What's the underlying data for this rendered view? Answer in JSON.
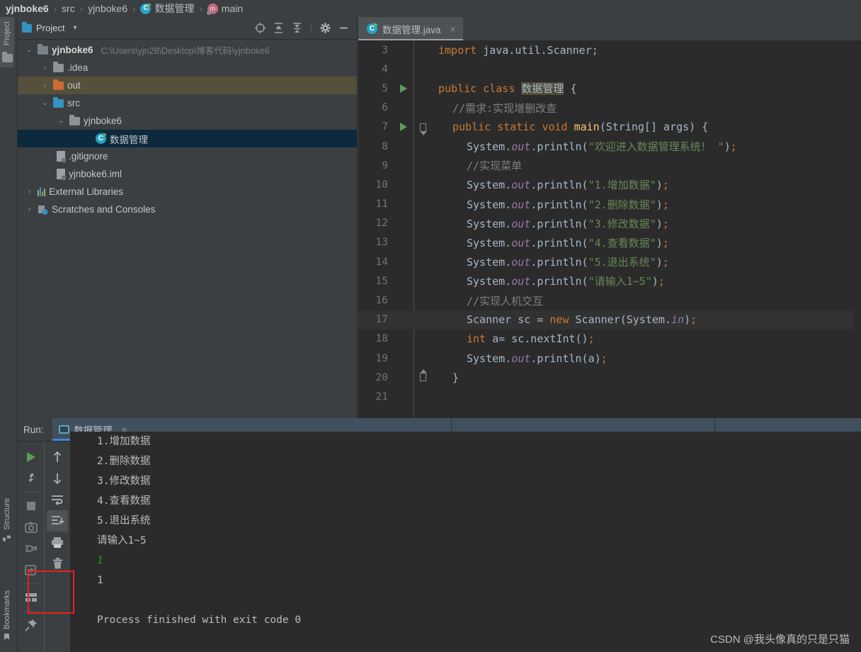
{
  "breadcrumb": {
    "items": [
      {
        "label": "yjnboke6",
        "bold": true,
        "icon": null
      },
      {
        "label": "src",
        "bold": false,
        "icon": null
      },
      {
        "label": "yjnboke6",
        "bold": false,
        "icon": null
      },
      {
        "label": "数据管理",
        "bold": false,
        "icon": "java-class-icon"
      },
      {
        "label": "main",
        "bold": false,
        "icon": "java-method-icon"
      }
    ],
    "separator": "›"
  },
  "tool_strip": {
    "project_label": "Project",
    "structure_label": "Structure",
    "bookmarks_label": "Bookmarks"
  },
  "project_panel": {
    "title": "Project",
    "dropdown_caret": "▾",
    "icons": [
      "locate-icon",
      "expand-all-icon",
      "collapse-all-icon",
      "settings-icon",
      "hide-icon"
    ],
    "tree": [
      {
        "depth": 0,
        "arrow": "⌄",
        "icon": "module-folder-icon",
        "color": "#7a8287",
        "label": "yjnboke6",
        "bold": true,
        "path": "C:\\Users\\yjn28\\Desktop\\博客代码\\yjnboke6",
        "state": "none"
      },
      {
        "depth": 1,
        "arrow": "›",
        "icon": "folder-icon",
        "color": "#8d9499",
        "label": ".idea",
        "bold": false,
        "path": "",
        "state": "none"
      },
      {
        "depth": 1,
        "arrow": "›",
        "icon": "folder-icon",
        "color": "#cc7832",
        "label": "out",
        "bold": false,
        "path": "",
        "state": "out-selected"
      },
      {
        "depth": 1,
        "arrow": "⌄",
        "icon": "source-folder-icon",
        "color": "#3592c4",
        "label": "src",
        "bold": false,
        "path": "",
        "state": "none"
      },
      {
        "depth": 2,
        "arrow": "⌄",
        "icon": "package-icon",
        "color": "#8d9499",
        "label": "yjnboke6",
        "bold": false,
        "path": "",
        "state": "none"
      },
      {
        "depth": 3,
        "arrow": "",
        "icon": "java-class-icon",
        "color": "",
        "label": "数据管理",
        "bold": false,
        "path": "",
        "state": "focused"
      },
      {
        "depth": 2,
        "arrow": "",
        "icon": "gitignore-file-icon",
        "color": "",
        "label": ".gitignore",
        "bold": false,
        "path": "",
        "state": "none"
      },
      {
        "depth": 2,
        "arrow": "",
        "icon": "iml-file-icon",
        "color": "",
        "label": "yjnboke6.iml",
        "bold": false,
        "path": "",
        "state": "none"
      },
      {
        "depth": 0,
        "arrow": "›",
        "icon": "external-libraries-icon",
        "color": "",
        "label": "External Libraries",
        "bold": false,
        "path": "",
        "state": "none"
      },
      {
        "depth": 0,
        "arrow": "›",
        "icon": "scratches-icon",
        "color": "",
        "label": "Scratches and Consoles",
        "bold": false,
        "path": "",
        "state": "none"
      }
    ]
  },
  "editor": {
    "tab": {
      "label": "数据管理.java",
      "icon": "java-class-icon",
      "close": "×"
    },
    "lines": [
      {
        "n": "3",
        "run": false,
        "fold": "",
        "hl": false,
        "tokens": [
          {
            "t": "import ",
            "c": "kw"
          },
          {
            "t": "java.util.Scanner;",
            "c": "plain"
          }
        ],
        "indent": 1
      },
      {
        "n": "4",
        "run": false,
        "fold": "",
        "hl": false,
        "tokens": [],
        "indent": 1
      },
      {
        "n": "5",
        "run": true,
        "fold": "",
        "hl": false,
        "tokens": [
          {
            "t": "public ",
            "c": "kw"
          },
          {
            "t": "class ",
            "c": "kw"
          },
          {
            "t": "数据管理",
            "c": "hlid"
          },
          {
            "t": " {",
            "c": "plain"
          }
        ],
        "indent": 1
      },
      {
        "n": "6",
        "run": false,
        "fold": "",
        "hl": false,
        "tokens": [
          {
            "t": "//需求:实现增删改查",
            "c": "cmt"
          }
        ],
        "indent": 2
      },
      {
        "n": "7",
        "run": true,
        "fold": "start",
        "hl": false,
        "tokens": [
          {
            "t": "public ",
            "c": "kw"
          },
          {
            "t": "static ",
            "c": "kw"
          },
          {
            "t": "void ",
            "c": "kw"
          },
          {
            "t": "main",
            "c": "mth"
          },
          {
            "t": "(String[] args) {",
            "c": "plain"
          }
        ],
        "indent": 2
      },
      {
        "n": "8",
        "run": false,
        "fold": "",
        "hl": false,
        "tokens": [
          {
            "t": "System.",
            "c": "plain"
          },
          {
            "t": "out",
            "c": "field"
          },
          {
            "t": ".println(",
            "c": "plain"
          },
          {
            "t": "\"欢迎进入数据管理系统！ \"",
            "c": "str"
          },
          {
            "t": ")",
            "c": "plain"
          },
          {
            "t": ";",
            "c": "kw2"
          }
        ],
        "indent": 3
      },
      {
        "n": "9",
        "run": false,
        "fold": "",
        "hl": false,
        "tokens": [
          {
            "t": "//实现菜单",
            "c": "cmt"
          }
        ],
        "indent": 3
      },
      {
        "n": "10",
        "run": false,
        "fold": "",
        "hl": false,
        "tokens": [
          {
            "t": "System.",
            "c": "plain"
          },
          {
            "t": "out",
            "c": "field"
          },
          {
            "t": ".println(",
            "c": "plain"
          },
          {
            "t": "\"1.增加数据\"",
            "c": "str"
          },
          {
            "t": ")",
            "c": "plain"
          },
          {
            "t": ";",
            "c": "kw2"
          }
        ],
        "indent": 3
      },
      {
        "n": "11",
        "run": false,
        "fold": "",
        "hl": false,
        "tokens": [
          {
            "t": "System.",
            "c": "plain"
          },
          {
            "t": "out",
            "c": "field"
          },
          {
            "t": ".println(",
            "c": "plain"
          },
          {
            "t": "\"2.删除数据\"",
            "c": "str"
          },
          {
            "t": ")",
            "c": "plain"
          },
          {
            "t": ";",
            "c": "kw2"
          }
        ],
        "indent": 3
      },
      {
        "n": "12",
        "run": false,
        "fold": "",
        "hl": false,
        "tokens": [
          {
            "t": "System.",
            "c": "plain"
          },
          {
            "t": "out",
            "c": "field"
          },
          {
            "t": ".println(",
            "c": "plain"
          },
          {
            "t": "\"3.修改数据\"",
            "c": "str"
          },
          {
            "t": ")",
            "c": "plain"
          },
          {
            "t": ";",
            "c": "kw2"
          }
        ],
        "indent": 3
      },
      {
        "n": "13",
        "run": false,
        "fold": "",
        "hl": false,
        "tokens": [
          {
            "t": "System.",
            "c": "plain"
          },
          {
            "t": "out",
            "c": "field"
          },
          {
            "t": ".println(",
            "c": "plain"
          },
          {
            "t": "\"4.查看数据\"",
            "c": "str"
          },
          {
            "t": ")",
            "c": "plain"
          },
          {
            "t": ";",
            "c": "kw2"
          }
        ],
        "indent": 3
      },
      {
        "n": "14",
        "run": false,
        "fold": "",
        "hl": false,
        "tokens": [
          {
            "t": "System.",
            "c": "plain"
          },
          {
            "t": "out",
            "c": "field"
          },
          {
            "t": ".println(",
            "c": "plain"
          },
          {
            "t": "\"5.退出系统\"",
            "c": "str"
          },
          {
            "t": ")",
            "c": "plain"
          },
          {
            "t": ";",
            "c": "kw2"
          }
        ],
        "indent": 3
      },
      {
        "n": "15",
        "run": false,
        "fold": "",
        "hl": false,
        "tokens": [
          {
            "t": "System.",
            "c": "plain"
          },
          {
            "t": "out",
            "c": "field"
          },
          {
            "t": ".println(",
            "c": "plain"
          },
          {
            "t": "\"请输入1~5\"",
            "c": "str"
          },
          {
            "t": ")",
            "c": "plain"
          },
          {
            "t": ";",
            "c": "kw2"
          }
        ],
        "indent": 3
      },
      {
        "n": "16",
        "run": false,
        "fold": "",
        "hl": false,
        "tokens": [
          {
            "t": "//实现人机交互",
            "c": "cmt"
          }
        ],
        "indent": 3
      },
      {
        "n": "17",
        "run": false,
        "fold": "",
        "hl": true,
        "tokens": [
          {
            "t": "Scanner sc = ",
            "c": "plain"
          },
          {
            "t": "new ",
            "c": "kw"
          },
          {
            "t": "Scanner(System.",
            "c": "plain"
          },
          {
            "t": "in",
            "c": "field"
          },
          {
            "t": ")",
            "c": "plain"
          },
          {
            "t": ";",
            "c": "kw2"
          }
        ],
        "indent": 3
      },
      {
        "n": "18",
        "run": false,
        "fold": "",
        "hl": false,
        "tokens": [
          {
            "t": "int ",
            "c": "kw"
          },
          {
            "t": "a= sc.nextInt()",
            "c": "plain"
          },
          {
            "t": ";",
            "c": "kw2"
          }
        ],
        "indent": 3
      },
      {
        "n": "19",
        "run": false,
        "fold": "",
        "hl": false,
        "tokens": [
          {
            "t": "System.",
            "c": "plain"
          },
          {
            "t": "out",
            "c": "field"
          },
          {
            "t": ".println(a)",
            "c": "plain"
          },
          {
            "t": ";",
            "c": "kw2"
          }
        ],
        "indent": 3
      },
      {
        "n": "20",
        "run": false,
        "fold": "end",
        "hl": false,
        "tokens": [
          {
            "t": "}",
            "c": "plain"
          }
        ],
        "indent": 2
      },
      {
        "n": "21",
        "run": false,
        "fold": "",
        "hl": false,
        "tokens": [],
        "indent": 1
      }
    ]
  },
  "run_panel": {
    "label": "Run:",
    "tab": {
      "label": "数据管理",
      "icon": "console-icon",
      "close": "×"
    },
    "toolbar_left": [
      "rerun-icon",
      "settings-wrench-icon",
      "stop-icon",
      "screenshot-icon",
      "debug-attach-icon",
      "export-icon",
      "layout-icon",
      "pin-icon"
    ],
    "toolbar_right": [
      "up-arrow-icon",
      "down-arrow-icon",
      "soft-wrap-icon",
      "scroll-to-end-icon",
      "print-icon",
      "clear-all-icon"
    ],
    "console_lines": [
      {
        "text": "1.增加数据",
        "kind": "out"
      },
      {
        "text": "2.删除数据",
        "kind": "out"
      },
      {
        "text": "3.修改数据",
        "kind": "out"
      },
      {
        "text": "4.查看数据",
        "kind": "out"
      },
      {
        "text": "5.退出系统",
        "kind": "out"
      },
      {
        "text": "请输入1~5",
        "kind": "out"
      },
      {
        "text": "1",
        "kind": "input"
      },
      {
        "text": "1",
        "kind": "out"
      },
      {
        "text": "",
        "kind": "out"
      },
      {
        "text": "Process finished with exit code 0",
        "kind": "out"
      }
    ]
  },
  "watermark": "CSDN @我头像真的只是只猫",
  "colors": {
    "background": "#3c3f41",
    "editor_bg": "#2b2b2b",
    "selection_focus": "#0d293e",
    "selection_out": "#54503b",
    "tab_accent": "#3d88d8",
    "annotation_red": "#e81f1f",
    "keyword": "#cc7832",
    "string": "#6a8759",
    "comment": "#808080",
    "field": "#9876aa",
    "method": "#ffc66d"
  }
}
